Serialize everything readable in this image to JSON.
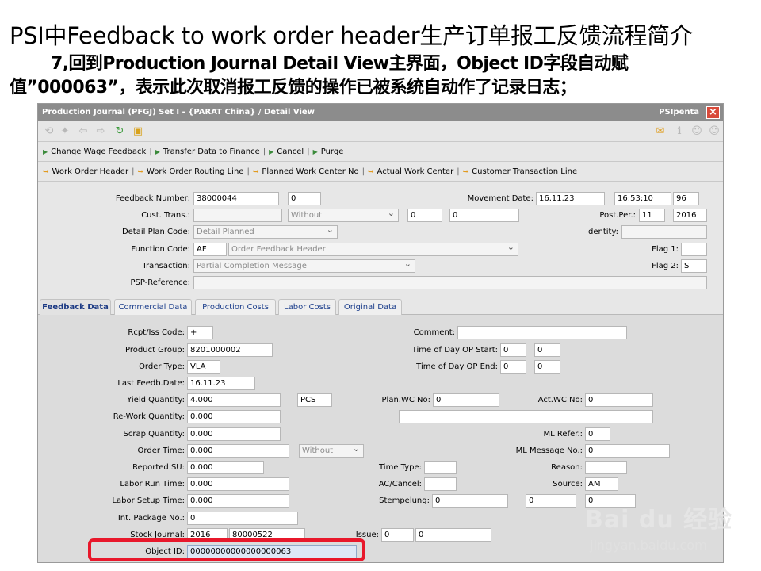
{
  "slide": {
    "title": "PSI中Feedback to work order header生产订单报工反馈流程简介",
    "subtitle_line1": "7,回到Production Journal Detail View主界面，Object ID字段自动赋",
    "subtitle_line2": "值”000063”，表示此次取消报工反馈的操作已被系统自动作了记录日志；"
  },
  "window": {
    "title": "Production Journal (PFGJ) Set I - {PARAT China} / Detail View",
    "brand": "PSIpenta",
    "close": "×"
  },
  "toolbar": {
    "icons": [
      "back-icon",
      "magic-wand-icon",
      "arrow-left-icon",
      "arrow-right-icon",
      "refresh-icon",
      "save-icon"
    ],
    "right_icons": [
      "mail-icon",
      "info-icon",
      "people-icon",
      "group-icon"
    ]
  },
  "menu": {
    "actions": [
      "Change Wage Feedback",
      "Transfer Data to Finance",
      "Cancel",
      "Purge"
    ],
    "links": [
      "Work Order Header",
      "Work Order Routing Line",
      "Planned Work Center No",
      "Actual Work Center",
      "Customer Transaction Line"
    ]
  },
  "header": {
    "feedback_number": {
      "label": "Feedback Number:",
      "value": "38000044",
      "value2": "0"
    },
    "movement_date": {
      "label": "Movement Date:",
      "date": "16.11.23",
      "time": "16:53:10",
      "extra": "96"
    },
    "cust_trans": {
      "label": "Cust. Trans.:",
      "value": "",
      "select": "Without",
      "v2": "0",
      "v3": "0"
    },
    "post_per": {
      "label": "Post.Per.:",
      "month": "11",
      "year": "2016"
    },
    "detail_plan_code": {
      "label": "Detail Plan.Code:",
      "value": "Detail Planned"
    },
    "identity": {
      "label": "Identity:",
      "value": ""
    },
    "function_code": {
      "label": "Function Code:",
      "code": "AF",
      "value": "Order Feedback Header"
    },
    "flag1": {
      "label": "Flag 1:",
      "value": ""
    },
    "transaction": {
      "label": "Transaction:",
      "value": "Partial Completion Message"
    },
    "flag2": {
      "label": "Flag 2:",
      "value": "S"
    },
    "psp_reference": {
      "label": "PSP-Reference:",
      "value": ""
    }
  },
  "tabs": [
    "Feedback Data",
    "Commercial Data",
    "Production Costs",
    "Labor Costs",
    "Original Data"
  ],
  "feedback": {
    "rcpt_iss_code": {
      "label": "Rcpt/Iss Code:",
      "value": "+"
    },
    "product_group": {
      "label": "Product Group:",
      "value": "8201000002"
    },
    "order_type": {
      "label": "Order Type:",
      "value": "VLA"
    },
    "last_feedb_date": {
      "label": "Last Feedb.Date:",
      "value": "16.11.23"
    },
    "yield_quantity": {
      "label": "Yield Quantity:",
      "value": "4.000",
      "unit": "PCS"
    },
    "rework_quantity": {
      "label": "Re-Work Quantity:",
      "value": "0.000"
    },
    "scrap_quantity": {
      "label": "Scrap Quantity:",
      "value": "0.000"
    },
    "order_time": {
      "label": "Order Time:",
      "value": "0.000",
      "select": "Without"
    },
    "reported_su": {
      "label": "Reported SU:",
      "value": "0.000"
    },
    "labor_run_time": {
      "label": "Labor Run Time:",
      "value": "0.000"
    },
    "labor_setup_time": {
      "label": "Labor Setup Time:",
      "value": "0.000"
    },
    "intl_package_no": {
      "label": "Int. Package No.:",
      "value": "0"
    },
    "stock_journal": {
      "label": "Stock Journal:",
      "year": "2016",
      "value": "80000522"
    },
    "object_id": {
      "label": "Object ID:",
      "value": "00000000000000000063"
    },
    "comment": {
      "label": "Comment:",
      "value": ""
    },
    "time_op_start": {
      "label": "Time of Day OP Start:",
      "v1": "0",
      "v2": "0"
    },
    "time_op_end": {
      "label": "Time of Day OP End:",
      "v1": "0",
      "v2": "0"
    },
    "plan_wc_no": {
      "label": "Plan.WC No:",
      "value": "0"
    },
    "act_wc_no": {
      "label": "Act.WC No:",
      "value": "0"
    },
    "ml_refer": {
      "label": "ML Refer.:",
      "value": "0"
    },
    "ml_message_no": {
      "label": "ML Message No.:",
      "value": "0"
    },
    "time_type": {
      "label": "Time Type:",
      "value": ""
    },
    "reason": {
      "label": "Reason:",
      "value": ""
    },
    "ac_cancel": {
      "label": "AC/Cancel:",
      "value": ""
    },
    "source": {
      "label": "Source:",
      "value": "AM"
    },
    "stempelung": {
      "label": "Stempelung:",
      "v1": "0",
      "v2": "0",
      "v3": "0"
    },
    "issue": {
      "label": "Issue:",
      "v1": "0",
      "v2": "0"
    }
  },
  "watermark": {
    "brand": "Bai du 经验",
    "url": "jingyan.baidu.com"
  },
  "colors": {
    "titlebar": "#8c8c8c",
    "highlight": "#e8182b",
    "tab_text": "#1d3f8c"
  }
}
